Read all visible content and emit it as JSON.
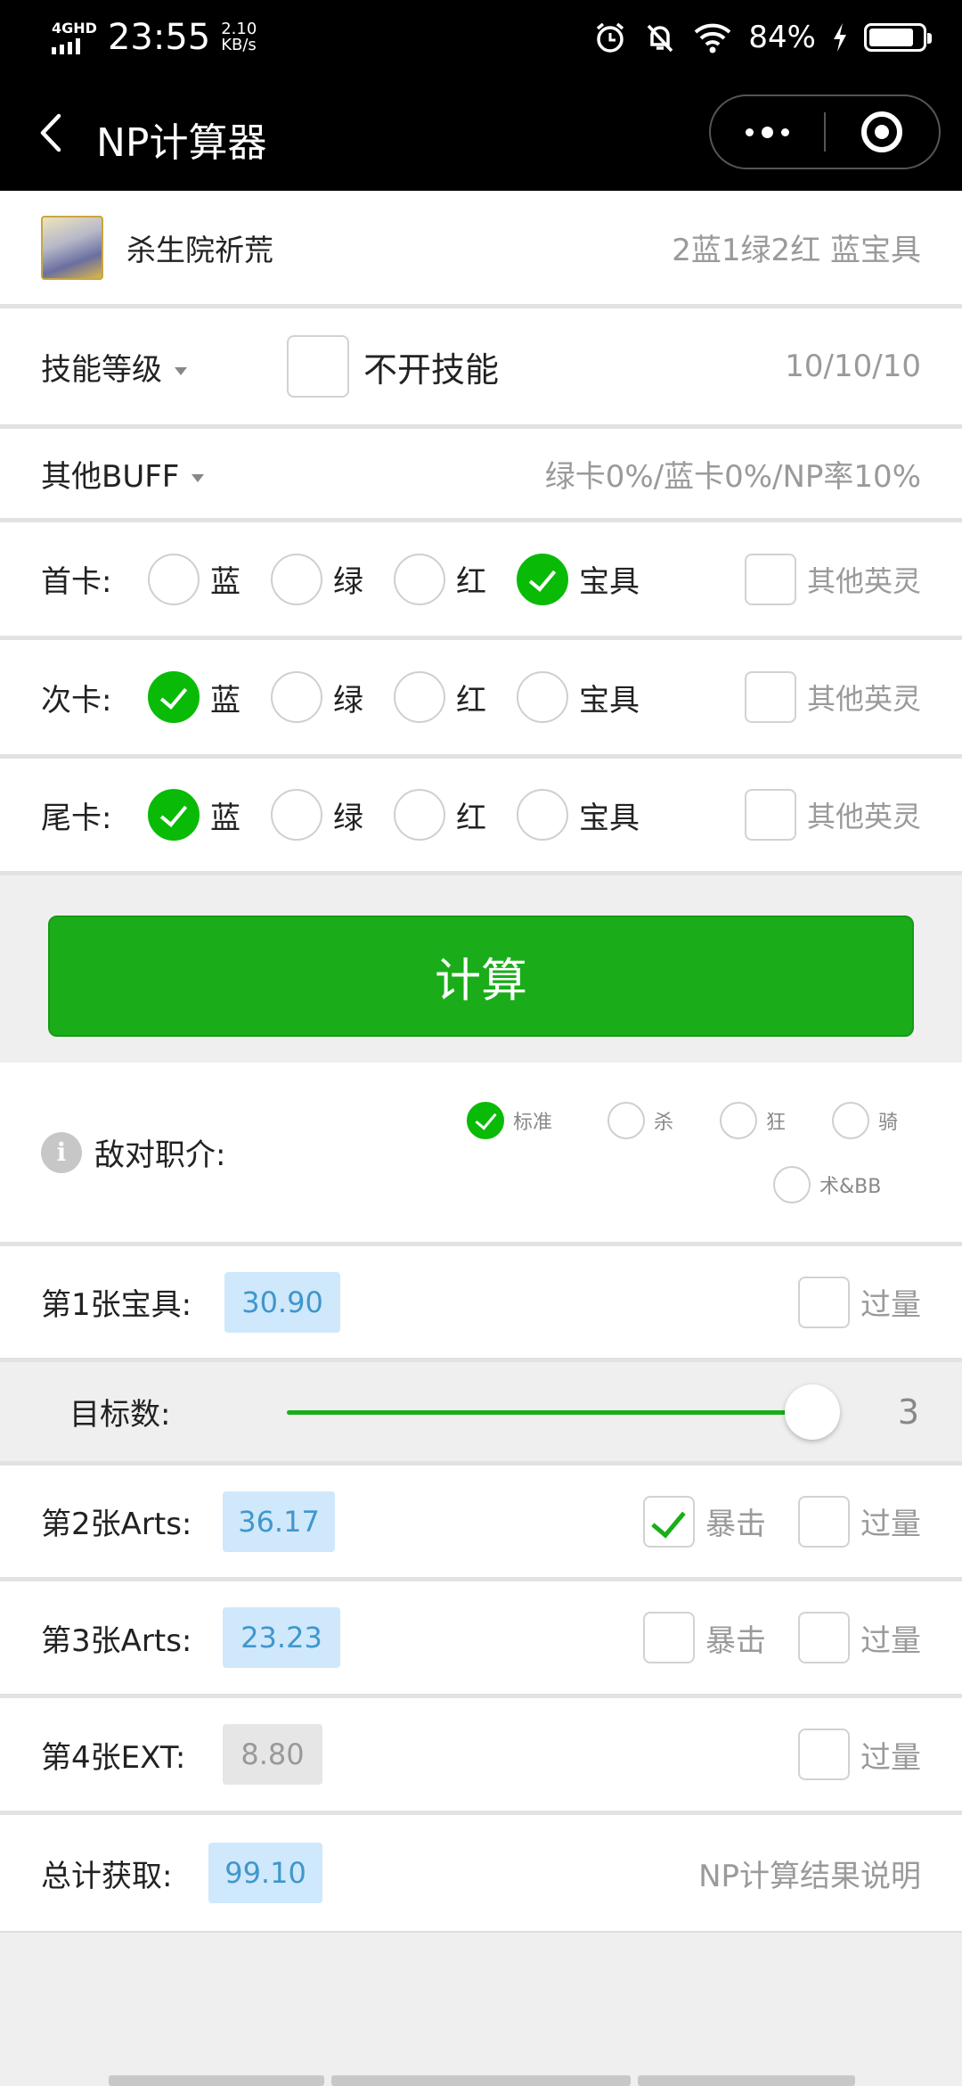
{
  "status_bar": {
    "network": "4GHD",
    "time": "23:55",
    "speed_value": "2.10",
    "speed_unit": "KB/s",
    "battery_percent": "84%",
    "battery_level": 0.84
  },
  "nav": {
    "title": "NP计算器"
  },
  "servant": {
    "name": "杀生院祈荒",
    "cards": "2蓝1绿2红 蓝宝具"
  },
  "skill": {
    "label": "技能等级",
    "toggle_label": "不开技能",
    "levels": "10/10/10"
  },
  "buff": {
    "label": "其他BUFF",
    "summary": "绿卡0%/蓝卡0%/NP率10%"
  },
  "card_options": [
    "蓝",
    "绿",
    "红",
    "宝具"
  ],
  "other_servant_label": "其他英灵",
  "card_rows": [
    {
      "label": "首卡:",
      "selected": "宝具"
    },
    {
      "label": "次卡:",
      "selected": "蓝"
    },
    {
      "label": "尾卡:",
      "selected": "蓝"
    }
  ],
  "calc_button": "计算",
  "enemy": {
    "label": "敌对职介:",
    "info_icon": "i",
    "options": [
      "标准",
      "杀",
      "狂",
      "骑",
      "术&BB"
    ],
    "selected": "标准"
  },
  "overkill_label": "过量",
  "crit_label": "暴击",
  "results": [
    {
      "label": "第1张宝具:",
      "value": "30.90"
    },
    {
      "label": "第2张Arts:",
      "value": "36.17",
      "crit": true
    },
    {
      "label": "第3张Arts:",
      "value": "23.23",
      "crit": false
    },
    {
      "label": "第4张EXT:",
      "value": "8.80"
    }
  ],
  "targets": {
    "label": "目标数:",
    "value": "3",
    "level": 1.0
  },
  "total": {
    "label": "总计获取:",
    "value": "99.10",
    "link": "NP计算结果说明"
  }
}
